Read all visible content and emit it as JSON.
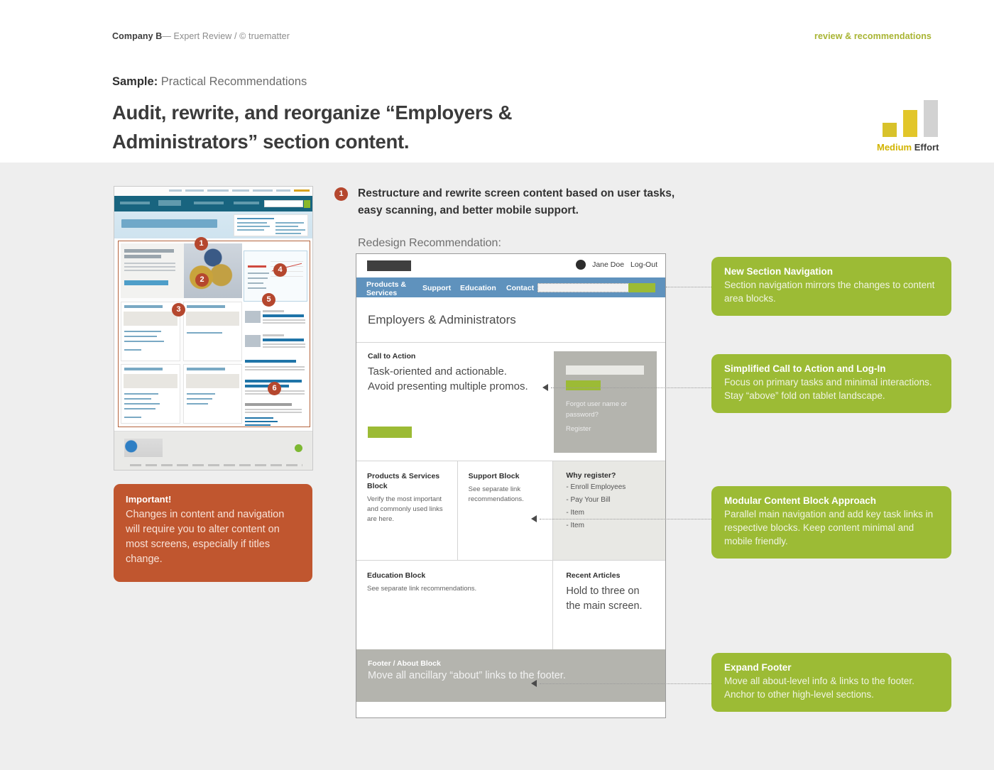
{
  "header": {
    "company": "Company B",
    "subtitle": "— Expert Review / © truematter",
    "deck_label": "review & recommendations",
    "sample_prefix": "Sample:",
    "sample_text": " Practical Recommendations",
    "title": "Audit, rewrite, and reorganize “Employers & Administrators” section content."
  },
  "effort": {
    "level": "Medium",
    "word": " Effort",
    "bars": [
      20,
      38,
      52
    ],
    "colors": [
      "#d8c22b",
      "#e2c62a",
      "#d2d2d2"
    ]
  },
  "recommendation": {
    "number": "1",
    "heading": "Restructure and rewrite screen content based on user tasks, easy scanning, and better mobile support.",
    "redesign_label": "Redesign Recommendation:"
  },
  "thumbnail": {
    "markers": [
      "1",
      "2",
      "3",
      "4",
      "5",
      "6"
    ]
  },
  "important": {
    "title": "Important!",
    "body": "Changes in content and navigation will require you to alter content on most screens, especially if titles change."
  },
  "wireframe": {
    "user_name": "Jane Doe",
    "logout": "Log-Out",
    "nav": {
      "products_services": "Products & Services",
      "support": "Support",
      "education": "Education",
      "contact": "Contact"
    },
    "hero_title": "Employers & Administrators",
    "cta": {
      "label": "Call to Action",
      "copy": "Task-oriented and actionable. Avoid presenting multiple promos."
    },
    "login": {
      "forgot": "Forgot user name or password?",
      "register": "Register"
    },
    "blocks": {
      "products": {
        "title": "Products & Services Block",
        "body": "Verify the most important and commonly used links are here."
      },
      "support": {
        "title": "Support Block",
        "body": "See separate link recommendations."
      },
      "why_register": {
        "title": "Why register?",
        "items": [
          "- Enroll Employees",
          "- Pay Your Bill",
          "- Item",
          "- Item"
        ]
      },
      "education": {
        "title": "Education Block",
        "body": "See separate link recommendations."
      },
      "recent_articles": {
        "title": "Recent Articles",
        "body": "Hold to three on the main screen."
      }
    },
    "footer": {
      "title": "Footer / About Block",
      "copy": "Move all ancillary “about” links to the footer."
    }
  },
  "callouts": [
    {
      "title": "New Section Navigation",
      "body": "Section navigation mirrors the changes to content area blocks."
    },
    {
      "title": "Simplified Call to Action and Log-In",
      "body": "Focus on primary tasks and minimal interactions. Stay “above” fold on tablet landscape."
    },
    {
      "title": "Modular Content Block Approach",
      "body": "Parallel main navigation and add key task links in respective blocks. Keep content minimal and mobile friendly."
    },
    {
      "title": "Expand Footer",
      "body": "Move all about-level info & links to the footer. Anchor to other high-level sections."
    }
  ],
  "colors": {
    "green": "#9cbb35",
    "orange": "#c0562f",
    "marker_red": "#b5472e",
    "nav_blue": "#5f92bd",
    "grey_panel": "#b4b4ae",
    "page_bg": "#eeeeee"
  }
}
